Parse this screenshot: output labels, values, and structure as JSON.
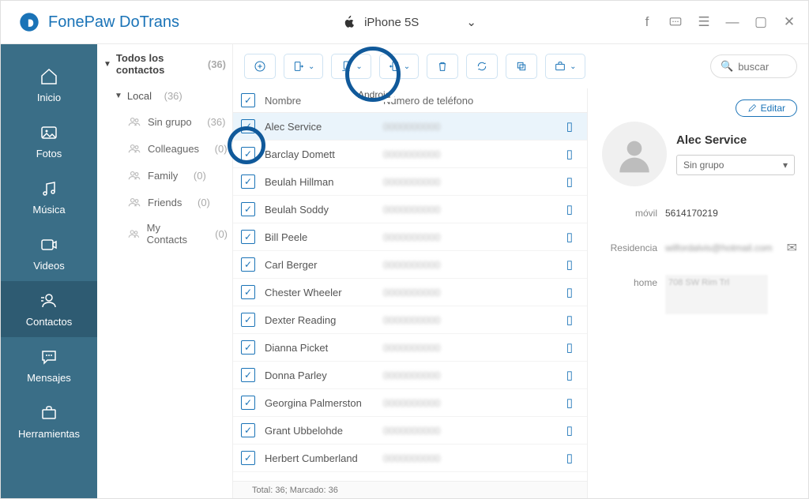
{
  "app": {
    "name": "FonePaw DoTrans"
  },
  "device": {
    "name": "iPhone 5S"
  },
  "sidebar": {
    "items": [
      {
        "label": "Inicio"
      },
      {
        "label": "Fotos"
      },
      {
        "label": "Música"
      },
      {
        "label": "Videos"
      },
      {
        "label": "Contactos"
      },
      {
        "label": "Mensajes"
      },
      {
        "label": "Herramientas"
      }
    ]
  },
  "tree": {
    "all_label": "Todos los contactos",
    "all_count": "(36)",
    "local_label": "Local",
    "local_count": "(36)",
    "groups": [
      {
        "label": "Sin grupo",
        "count": "(36)"
      },
      {
        "label": "Colleagues",
        "count": "(0)"
      },
      {
        "label": "Family",
        "count": "(0)"
      },
      {
        "label": "Friends",
        "count": "(0)"
      },
      {
        "label": "My Contacts",
        "count": "(0)"
      }
    ]
  },
  "toolbar": {
    "android_label": "Android",
    "search_placeholder": "buscar"
  },
  "columns": {
    "name": "Nombre",
    "phone": "Número de teléfono"
  },
  "contacts": [
    {
      "name": "Alec Service"
    },
    {
      "name": "Barclay Domett"
    },
    {
      "name": "Beulah Hillman"
    },
    {
      "name": "Beulah Soddy"
    },
    {
      "name": "Bill Peele"
    },
    {
      "name": "Carl Berger"
    },
    {
      "name": "Chester Wheeler"
    },
    {
      "name": "Dexter Reading"
    },
    {
      "name": "Dianna Picket"
    },
    {
      "name": "Donna Parley"
    },
    {
      "name": "Georgina Palmerston"
    },
    {
      "name": "Grant Ubbelohde"
    },
    {
      "name": "Herbert Cumberland"
    }
  ],
  "status": {
    "text": "Total: 36; Marcado: 36"
  },
  "detail": {
    "edit_label": "Editar",
    "name": "Alec Service",
    "group": "Sin grupo",
    "fields": {
      "mobile_label": "móvil",
      "mobile_value": "5614170219",
      "home_mail_label": "Residencia",
      "home_mail_value": "wilfordalvis@hotmail.com",
      "home_addr_label": "home",
      "home_addr_value": "708 SW Rim Trl"
    }
  }
}
